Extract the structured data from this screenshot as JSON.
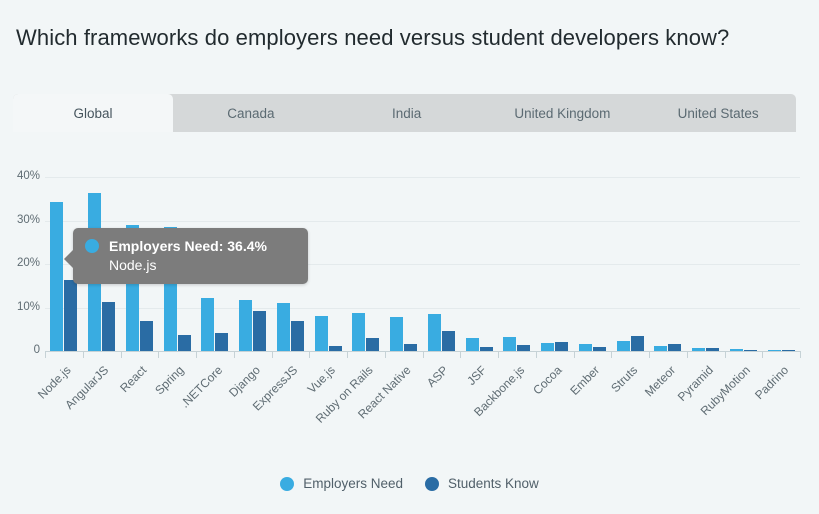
{
  "header": {
    "title": "Which frameworks do employers need versus student developers know?"
  },
  "tabs": [
    {
      "label": "Global",
      "active": true
    },
    {
      "label": "Canada",
      "active": false
    },
    {
      "label": "India",
      "active": false
    },
    {
      "label": "United Kingdom",
      "active": false
    },
    {
      "label": "United States",
      "active": false
    }
  ],
  "tooltip": {
    "header": "Employers Need: 36.4%",
    "subtitle": "Node.js",
    "dot_color": "#39ace1"
  },
  "legend": [
    {
      "label": "Employers Need",
      "color": "#39ace1"
    },
    {
      "label": "Students Know",
      "color": "#2a6ca4"
    }
  ],
  "colors": {
    "employers_need": "#39ace1",
    "students_know": "#2a6ca4",
    "background": "#f2f6f7",
    "tab_bar": "#d5d8d9",
    "tab_active": "#f4f7f8",
    "gridline": "#e4eaec",
    "axis": "#c6d2d6",
    "tooltip_bg": "#7c7c7c"
  },
  "chart_data": {
    "type": "bar",
    "title": "Which frameworks do employers need versus student developers know?",
    "xlabel": "",
    "ylabel": "",
    "ylim": [
      0,
      40
    ],
    "ytick_labels": [
      "0",
      "10%",
      "20%",
      "30%",
      "40%"
    ],
    "ytick_values": [
      0,
      10,
      20,
      30,
      40
    ],
    "grid": true,
    "legend_position": "bottom",
    "categories": [
      "Node.js",
      "AngularJS",
      "React",
      "Spring",
      ".NETCore",
      "Django",
      "ExpressJS",
      "Vue.js",
      "Ruby on Rails",
      "React Native",
      "ASP",
      "JSF",
      "Backbone.js",
      "Cocoa",
      "Ember",
      "Struts",
      "Meteor",
      "Pyramid",
      "RubyMotion",
      "Padrino"
    ],
    "series": [
      {
        "name": "Employers Need",
        "color": "#39ace1",
        "values": [
          34.3,
          36.4,
          28.9,
          28.4,
          12.2,
          11.8,
          11.0,
          8.0,
          8.7,
          7.8,
          8.6,
          2.9,
          3.2,
          1.9,
          1.5,
          2.4,
          1.1,
          0.8,
          0.4,
          0.2
        ]
      },
      {
        "name": "Students Know",
        "color": "#2a6ca4",
        "values": [
          16.3,
          11.2,
          7.0,
          3.7,
          4.2,
          9.3,
          6.8,
          1.1,
          3.0,
          1.6,
          4.7,
          1.0,
          1.4,
          2.1,
          0.9,
          3.4,
          1.5,
          0.8,
          0.3,
          0.2
        ]
      }
    ]
  }
}
